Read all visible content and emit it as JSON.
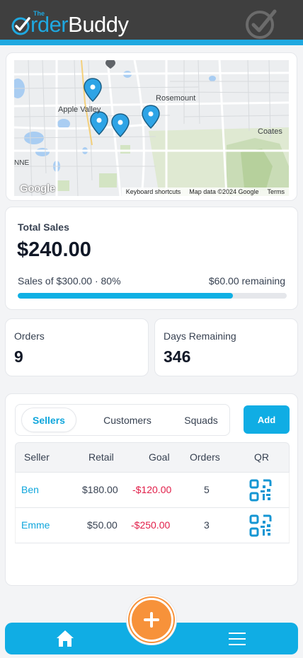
{
  "app": {
    "logo_the": "The",
    "logo_order": "rder",
    "logo_buddy": "Buddy",
    "accent": "#1fa8e0"
  },
  "map": {
    "labels": [
      "Rosemount",
      "Apple Valley",
      "Coates",
      "NNE",
      "Rosemount"
    ],
    "place_rosemount": "Rosemount",
    "place_apple_valley": "Apple Valley",
    "place_coates": "Coates",
    "place_edge": "NNE",
    "brand": "Google",
    "footer_shortcuts": "Keyboard shortcuts",
    "footer_data": "Map data ©2024 Google",
    "footer_terms": "Terms"
  },
  "sales": {
    "title": "Total Sales",
    "amount": "$240.00",
    "subtitle": "Sales of $300.00 · 80%",
    "remaining": "$60.00 remaining",
    "progress_fraction": 0.8
  },
  "stats": {
    "orders_label": "Orders",
    "orders_value": "9",
    "days_label": "Days Remaining",
    "days_value": "346"
  },
  "tabs": {
    "sellers": "Sellers",
    "customers": "Customers",
    "squads": "Squads",
    "active": "Sellers",
    "add_label": "Add"
  },
  "table": {
    "columns": [
      "Seller",
      "Retail",
      "Goal",
      "Orders",
      "QR"
    ],
    "rows": [
      {
        "seller": "Ben",
        "retail": "$180.00",
        "goal": "-$120.00",
        "orders": "5"
      },
      {
        "seller": "Emme",
        "retail": "$50.00",
        "goal": "-$250.00",
        "orders": "3"
      }
    ]
  },
  "nav": {
    "home_icon": "home-icon",
    "add_icon": "plus-icon",
    "menu_icon": "hamburger-menu-icon"
  }
}
